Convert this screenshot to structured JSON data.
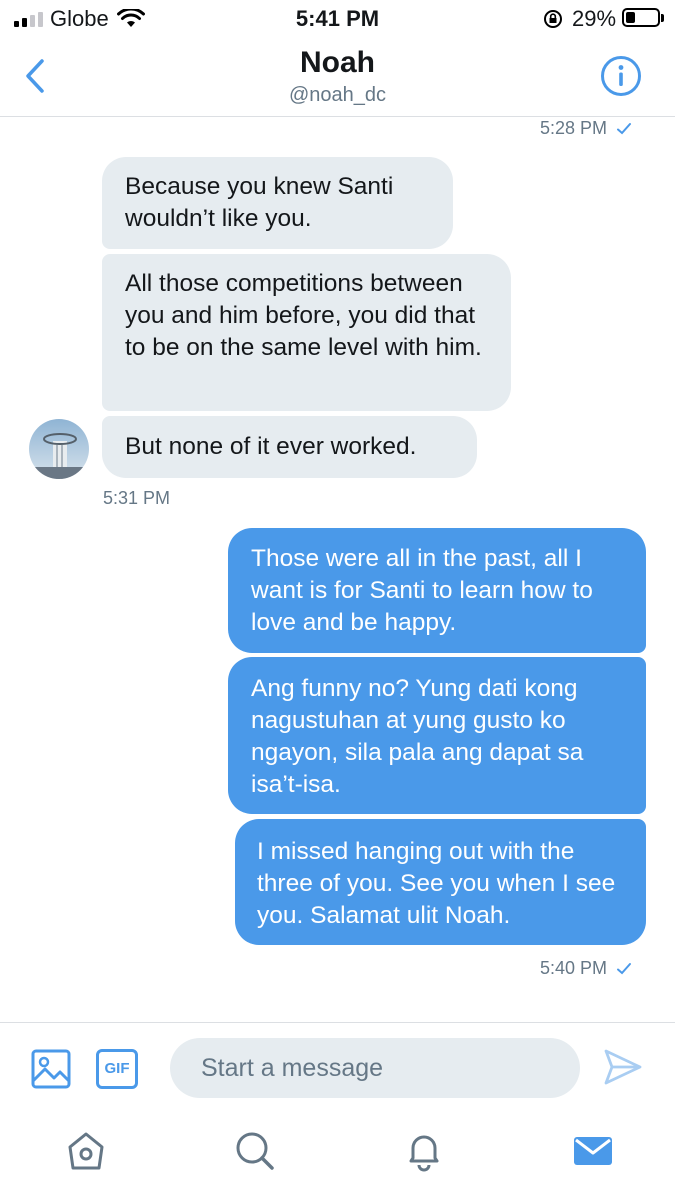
{
  "status_bar": {
    "carrier": "Globe",
    "time": "5:41 PM",
    "battery": "29%",
    "battery_level": 0.29
  },
  "header": {
    "name": "Noah",
    "handle": "@noah_dc",
    "back_icon": "chevron-left-icon",
    "info_icon": "info-icon"
  },
  "conversation": {
    "top_timestamp": "5:28 PM",
    "received": [
      "Because you knew Santi wouldn’t like you.",
      "All those competitions between you and him before, you did that to be on the same level with him.",
      "But none of it ever worked."
    ],
    "received_timestamp": "5:31 PM",
    "sent": [
      "Those were all in the past, all I want is for Santi to learn how to love and be happy.",
      "Ang funny no? Yung dati kong nagustuhan at yung gusto ko ngayon, sila pala ang dapat sa isa’t-isa.",
      "I missed hanging out with the three of you. See you when I see you. Salamat ulit Noah."
    ],
    "sent_timestamp": "5:40 PM"
  },
  "composer": {
    "placeholder": "Start a message",
    "gif_label": "GIF",
    "media_icon": "image-icon",
    "send_icon": "send-icon"
  },
  "tabbar": {
    "items": [
      "home-icon",
      "search-icon",
      "notifications-icon",
      "messages-icon"
    ]
  },
  "colors": {
    "accent": "#4a99e9",
    "received_bubble": "#e6ecf0",
    "muted_text": "#657786"
  }
}
